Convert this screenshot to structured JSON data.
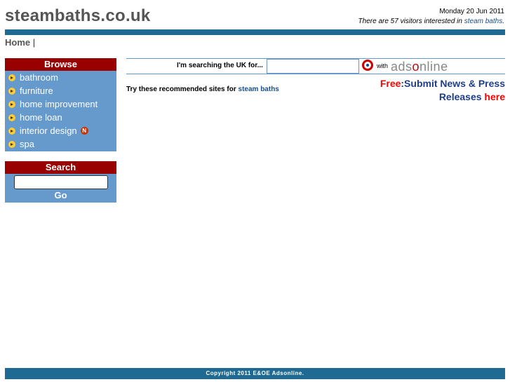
{
  "header": {
    "site_title": "steambaths.co.uk",
    "date": "Monday 20 Jun 2011",
    "visitors_prefix": "There are 57 visitors interested in ",
    "visitors_link": "steam baths",
    "visitors_suffix": "."
  },
  "breadcrumb": {
    "home": "Home",
    "separator": "|"
  },
  "browse": {
    "title": "Browse",
    "items": [
      {
        "label": "bathroom"
      },
      {
        "label": "furniture"
      },
      {
        "label": "home improvement"
      },
      {
        "label": "home loan"
      },
      {
        "label": "interior design",
        "badge": "N"
      },
      {
        "label": "spa"
      }
    ]
  },
  "search_panel": {
    "title": "Search",
    "input_value": "",
    "button_label": "Go"
  },
  "search_strip": {
    "label": "I'm searching the UK for...",
    "input_value": "",
    "with": "with",
    "brand_pre": "ads",
    "brand_o": "o",
    "brand_post": "nline"
  },
  "main": {
    "recommend_prefix": "Try these recommended sites for ",
    "recommend_link": "steam baths"
  },
  "promo": {
    "free": "Free",
    "line1": ":Submit News & Press",
    "line2": "Releases ",
    "here": "here"
  },
  "footer": {
    "text": "Copyright 2011 E&OE Adsonline."
  },
  "colors": {
    "bar": "#1e6a93",
    "panel": "#6699cc",
    "panel_header": "#990000",
    "link": "#1a4f8a"
  }
}
